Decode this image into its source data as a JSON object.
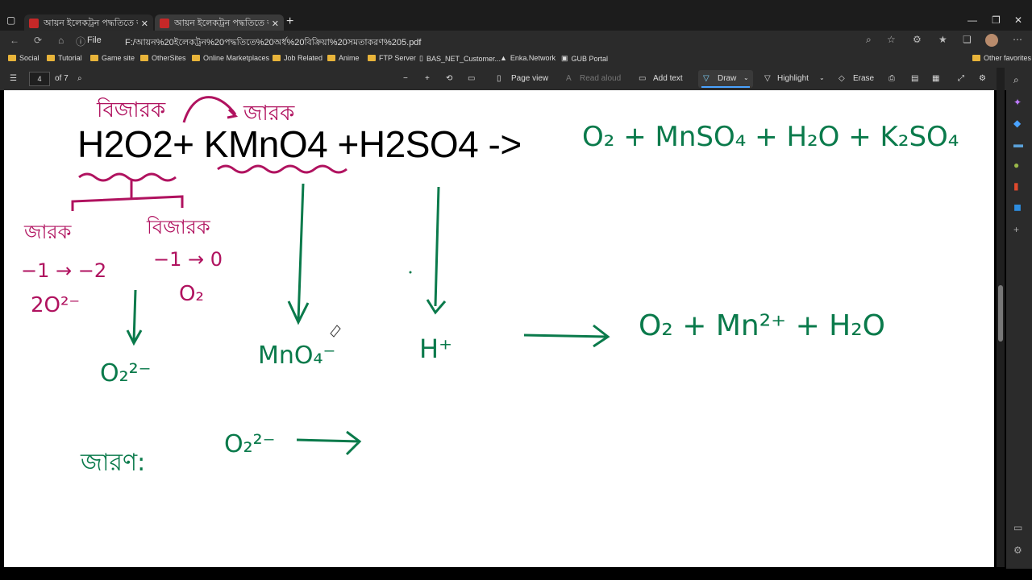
{
  "browser": {
    "tabs": [
      {
        "title": "আয়ন ইলেকট্রন পদ্ধতিতে অর্ধ বি"
      },
      {
        "title": "আয়ন ইলেকট্রন পদ্ধতিতে অর্ধ বি"
      }
    ],
    "file_label": "File",
    "url": "F:/আয়ন%20ইলেকট্রন%20পদ্ধতিতে%20অর্ধ%20বিক্রিয়া%20সমতাকরণ%205.pdf"
  },
  "bookmarks": [
    "Social",
    "Tutorial",
    "Game site",
    "OtherSites",
    "Online Marketplaces",
    "Job Related",
    "Anime",
    "FTP Server",
    "BAS_NET_Customer...",
    "Enka.Network",
    "GUB Portal"
  ],
  "other_favorites": "Other favorites",
  "pdf_toolbar": {
    "page_current": "4",
    "page_total": "of 7",
    "page_view": "Page view",
    "read_aloud": "Read aloud",
    "add_text": "Add text",
    "draw": "Draw",
    "highlight": "Highlight",
    "erase": "Erase"
  },
  "document": {
    "equation": "H2O2+ KMnO4 +H2SO4 ->",
    "annot_products": "O₂ + MnSO₄ + H₂O + K₂SO₄",
    "annot_bijarak_top": "বিজারক",
    "annot_jarak_top": "জারক",
    "annot_jarak": "জারক",
    "annot_bijarak": "বিজারক",
    "annot_ox1": "−1 → −2",
    "annot_ox2": "−1 → 0",
    "annot_2o": "2O²⁻",
    "annot_o2": "O₂",
    "annot_o2_2minus": "O₂²⁻",
    "annot_mno4": "MnO₄⁻",
    "annot_hplus": "H⁺",
    "annot_result": "O₂ + Mn²⁺ + H₂O",
    "annot_jaron": "জারণ:",
    "annot_o2_2minus_b": "O₂²⁻"
  },
  "colors": {
    "ink_green": "#0a7a4b",
    "ink_magenta": "#b0125f"
  }
}
